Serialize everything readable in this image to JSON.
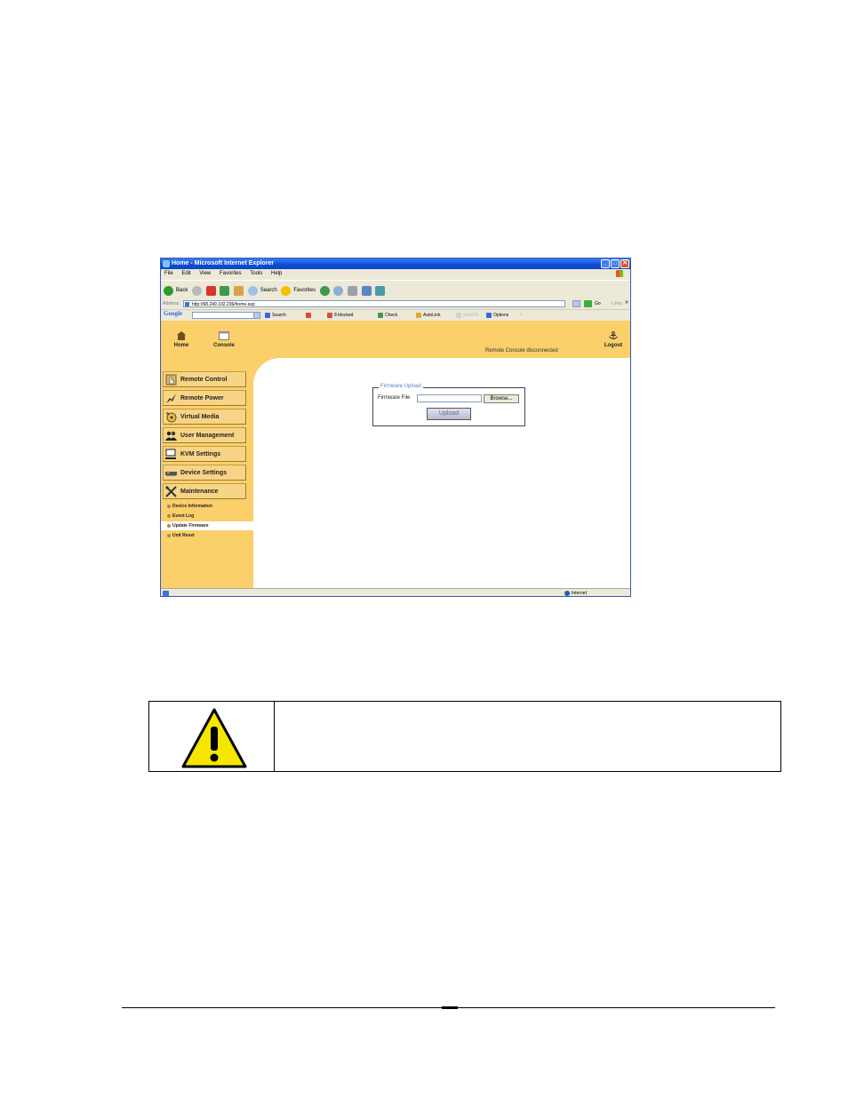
{
  "browser": {
    "title": "Home - Microsoft Internet Explorer",
    "menu": [
      "File",
      "Edit",
      "View",
      "Favorites",
      "Tools",
      "Help"
    ],
    "toolbar": {
      "back": "Back",
      "search": "Search",
      "favorites": "Favorites"
    },
    "address": {
      "label": "Address",
      "url": "http://68.249.192.236/home.asp",
      "go": "Go",
      "links": "Links"
    },
    "google": {
      "logo": "Google",
      "search": "Search",
      "blocked": "8 blocked",
      "check": "Check",
      "autolink": "AutoLink",
      "autofill": "AutoFill",
      "options": "Options"
    },
    "status": {
      "zone": "Internet"
    }
  },
  "app": {
    "nav": {
      "home": "Home",
      "console": "Console",
      "logout": "Logout"
    },
    "status_message": "Remote Console disconnected",
    "menu": [
      {
        "label": "Remote Control",
        "icon": "hand-pointer-icon"
      },
      {
        "label": "Remote Power",
        "icon": "lightning-icon"
      },
      {
        "label": "Virtual Media",
        "icon": "disc-icon"
      },
      {
        "label": "User Management",
        "icon": "users-icon"
      },
      {
        "label": "KVM Settings",
        "icon": "monitor-icon"
      },
      {
        "label": "Device Settings",
        "icon": "device-icon"
      },
      {
        "label": "Maintenance",
        "icon": "tools-icon"
      }
    ],
    "submenu": [
      "Device Information",
      "Event Log",
      "Update Firmware",
      "Unit Reset"
    ],
    "active_submenu": "Update Firmware",
    "firmware": {
      "legend": "Firmware Upload",
      "file_label": "Firmware File",
      "browse": "Browse...",
      "upload": "Upload"
    }
  },
  "colors": {
    "accent": "#fbcf6a",
    "warning": "#f5e600",
    "titlebar": "#0a4fd8"
  }
}
